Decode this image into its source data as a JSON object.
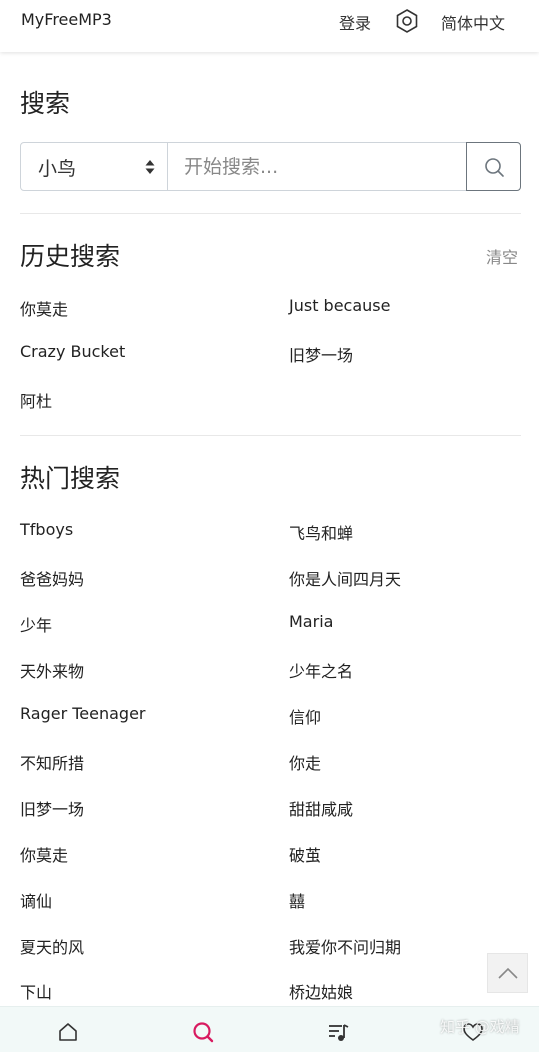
{
  "header": {
    "brand": "MyFreeMP3",
    "login": "登录",
    "language": "简体中文"
  },
  "search": {
    "title": "搜索",
    "source_selected": "小鸟",
    "placeholder": "开始搜索..."
  },
  "history": {
    "title": "历史搜索",
    "clear": "清空",
    "items": [
      "你莫走",
      "Just because",
      "Crazy Bucket",
      "旧梦一场",
      "阿杜"
    ]
  },
  "hot": {
    "title": "热门搜索",
    "items": [
      "Tfboys",
      "飞鸟和蝉",
      "爸爸妈妈",
      "你是人间四月天",
      "少年",
      "Maria",
      "天外来物",
      "少年之名",
      "Rager Teenager",
      "信仰",
      "不知所措",
      "你走",
      "旧梦一场",
      "甜甜咸咸",
      "你莫走",
      "破茧",
      "谪仙",
      "囍",
      "夏天的风",
      "我爱你不问归期",
      "下山",
      "桥边姑娘"
    ]
  },
  "watermark": "知乎 @戏精",
  "colors": {
    "accent": "#d81b60",
    "nav_bg": "#f2f9f8"
  },
  "icons": {
    "settings": "gear-icon",
    "search": "search-icon",
    "scroll_top": "chevron-up-icon",
    "home": "home-icon",
    "search_nav": "search-icon",
    "playlist": "playlist-icon",
    "favorite": "heart-icon"
  }
}
